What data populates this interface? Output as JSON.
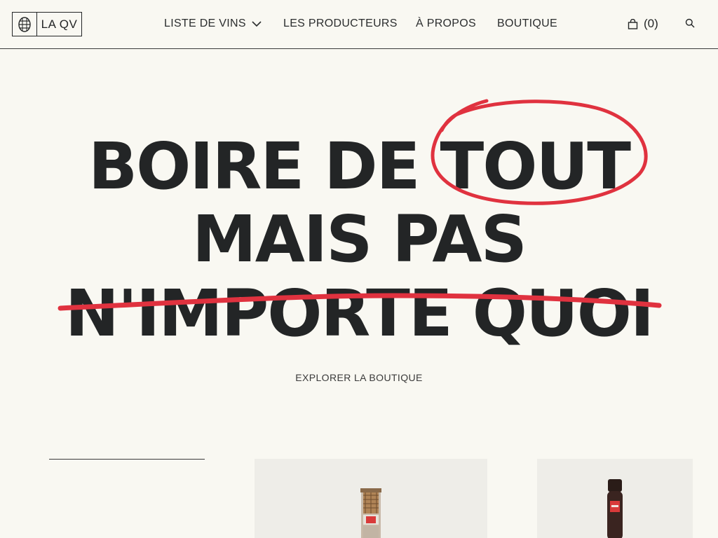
{
  "header": {
    "logo_text": "LA QV",
    "nav": [
      {
        "label": "LISTE DE VINS",
        "has_dropdown": true
      },
      {
        "label": "LES PRODUCTEURS",
        "has_dropdown": false
      },
      {
        "label": "À PROPOS",
        "has_dropdown": false
      },
      {
        "label": "BOUTIQUE",
        "has_dropdown": false
      }
    ],
    "cart_count": "(0)",
    "icons": {
      "logo": "barrel-icon",
      "dropdown": "chevron-down-icon",
      "cart": "shopping-bag-icon",
      "search": "search-icon"
    }
  },
  "hero": {
    "line1": "BOIRE DE TOUT",
    "line2": "MAIS PAS",
    "line3": "N'IMPORTE QUOI",
    "accent_color": "#e0323f",
    "text_color": "#232526"
  },
  "cta": {
    "label": "EXPLORER LA BOUTIQUE"
  },
  "products": [
    {
      "image": "wine-bottle-with-cork"
    },
    {
      "image": "dark-wine-bottle"
    }
  ],
  "colors": {
    "background": "#f9f8f2",
    "card": "#eeede8",
    "accent": "#e0323f"
  }
}
